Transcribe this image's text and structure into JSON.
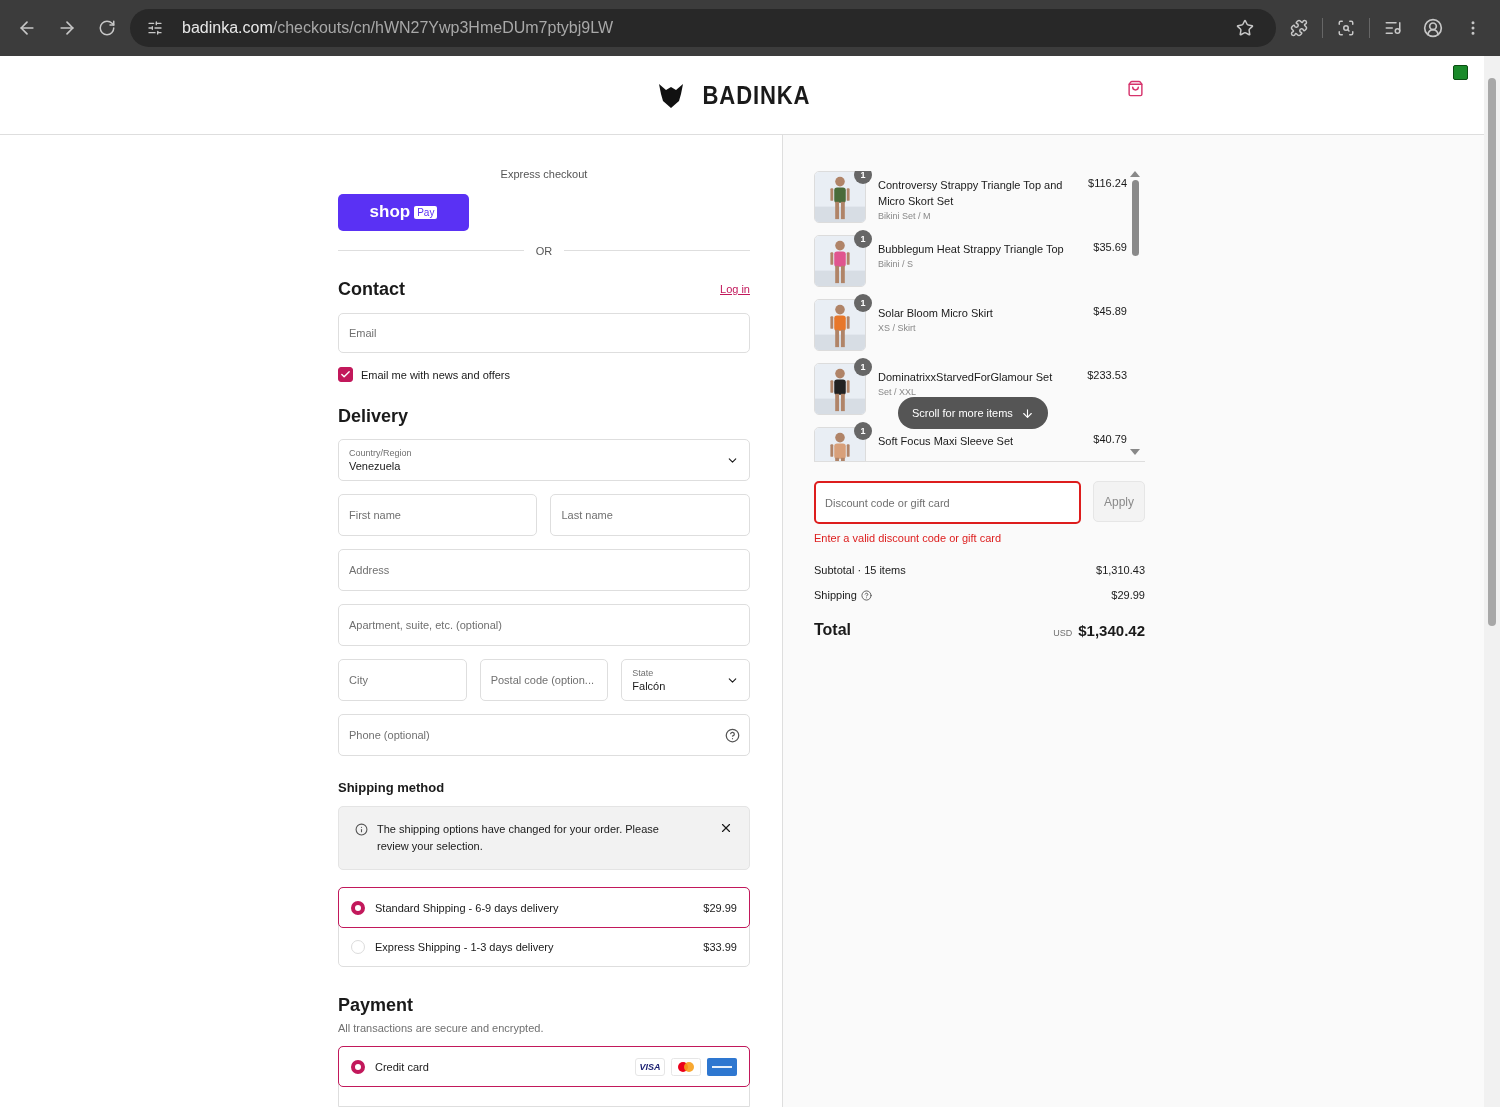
{
  "browser": {
    "url_host": "badinka.com",
    "url_path": "/checkouts/cn/hWN27Ywp3HmeDUm7ptybj9LW"
  },
  "header": {
    "logo": "BADINKA"
  },
  "express": {
    "label": "Express checkout",
    "shop": "shop",
    "pay": "Pay",
    "divider": "OR"
  },
  "contact": {
    "title": "Contact",
    "login": "Log in",
    "email": {
      "placeholder": "Email"
    },
    "news": {
      "label": "Email me with news and offers",
      "checked": true
    }
  },
  "delivery": {
    "title": "Delivery",
    "fields": [
      {
        "kind": "select",
        "label": "Country/Region",
        "value": "Venezuela"
      },
      {
        "kind": "input",
        "placeholder": "First name"
      },
      {
        "kind": "input",
        "placeholder": "Last name"
      },
      {
        "kind": "input",
        "placeholder": "Address"
      },
      {
        "kind": "input",
        "placeholder": "Apartment, suite, etc. (optional)"
      },
      {
        "kind": "input",
        "placeholder": "City"
      },
      {
        "kind": "input",
        "placeholder": "Postal code (option..."
      },
      {
        "kind": "select",
        "label": "State",
        "value": "Falcón"
      },
      {
        "kind": "help",
        "placeholder": "Phone (optional)"
      }
    ]
  },
  "shipping": {
    "title": "Shipping method",
    "notice": "The shipping options have changed for your order. Please review your selection.",
    "options": [
      {
        "label": "Standard Shipping - 6-9 days delivery",
        "price": "$29.99",
        "selected": true
      },
      {
        "label": "Express Shipping - 1-3 days delivery",
        "price": "$33.99",
        "selected": false
      }
    ]
  },
  "payment": {
    "title": "Payment",
    "subtitle": "All transactions are secure and encrypted.",
    "methods": [
      {
        "label": "Credit card",
        "selected": true
      }
    ],
    "cards": [
      {
        "kind": "visa",
        "label": "VISA"
      },
      {
        "kind": "mastercard"
      },
      {
        "kind": "amex"
      }
    ]
  },
  "summary": {
    "items": [
      {
        "name": "Controversy Strappy Triangle Top and Micro Skort Set",
        "variant": "Bikini Set / M",
        "price": "$116.24",
        "qty": "1"
      },
      {
        "name": "Bubblegum Heat Strappy Triangle Top",
        "variant": "Bikini / S",
        "price": "$35.69",
        "qty": "1"
      },
      {
        "name": "Solar Bloom Micro Skirt",
        "variant": "XS / Skirt",
        "price": "$45.89",
        "qty": "1"
      },
      {
        "name": "DominatrixxStarvedForGlamour Set",
        "variant": "Set / XXL",
        "price": "$233.53",
        "qty": "1"
      },
      {
        "name": "Soft Focus Maxi Sleeve Set",
        "price": "$40.79",
        "qty": "1"
      }
    ],
    "scroll_hint": "Scroll for more items",
    "discount": {
      "placeholder": "Discount code or gift card",
      "error": "Enter a valid discount code or gift card",
      "apply": "Apply"
    },
    "subtotal_label": "Subtotal · 15 items",
    "subtotal": "$1,310.43",
    "shipping_label": "Shipping",
    "shipping": "$29.99",
    "total_label": "Total",
    "currency": "USD",
    "total": "$1,340.42"
  }
}
